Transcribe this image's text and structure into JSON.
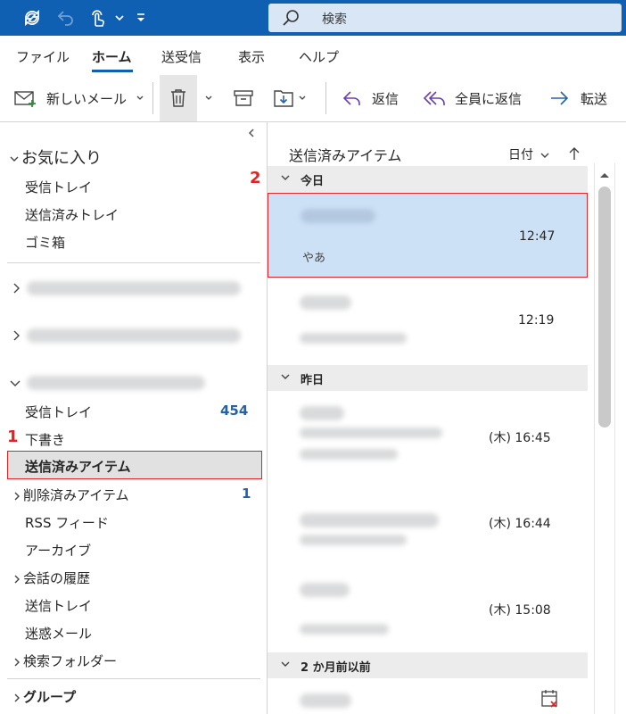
{
  "titlebar": {
    "search_placeholder": "検索",
    "icons": [
      "sync-icon",
      "undo-icon",
      "touch-mode-icon",
      "customize-toolbar-icon"
    ]
  },
  "menu": {
    "tabs": [
      "ファイル",
      "ホーム",
      "送受信",
      "表示",
      "ヘルプ"
    ],
    "active": "ホーム"
  },
  "ribbon": {
    "new_mail": "新しいメール",
    "reply": "返信",
    "reply_all": "全員に返信",
    "forward": "転送"
  },
  "folders": {
    "favorites_header": "お気に入り",
    "favorites": [
      "受信トレイ",
      "送信済みトレイ",
      "ゴミ箱"
    ],
    "account_items": {
      "inbox": "受信トレイ",
      "inbox_count": "454",
      "drafts": "下書き",
      "sent": "送信済みアイテム",
      "deleted": "削除済みアイテム",
      "deleted_count": "1",
      "rss": "RSS フィード",
      "archive": "アーカイブ",
      "conversation_history": "会話の履歴",
      "outbox": "送信トレイ",
      "junk": "迷惑メール",
      "search_folders": "検索フォルダー"
    },
    "groups_header": "グループ"
  },
  "annotations": {
    "step1": "1",
    "step2": "2",
    "accent": "#e02424"
  },
  "list": {
    "title": "送信済みアイテム",
    "sort_label": "日付",
    "groups": {
      "today": "今日",
      "yesterday": "昨日",
      "older": "2 か月前以前"
    },
    "messages": [
      {
        "time": "12:47",
        "preview": "やあ",
        "selected": true
      },
      {
        "time": "12:19",
        "preview": ""
      },
      {
        "time": "(木) 16:45",
        "preview": ""
      },
      {
        "time": "(木) 16:44",
        "preview": ""
      },
      {
        "time": "(木) 15:08",
        "preview": ""
      }
    ]
  },
  "colors": {
    "brand": "#0f5fb3",
    "selected_bg": "#cde1f6",
    "count_blue": "#2563a8"
  }
}
